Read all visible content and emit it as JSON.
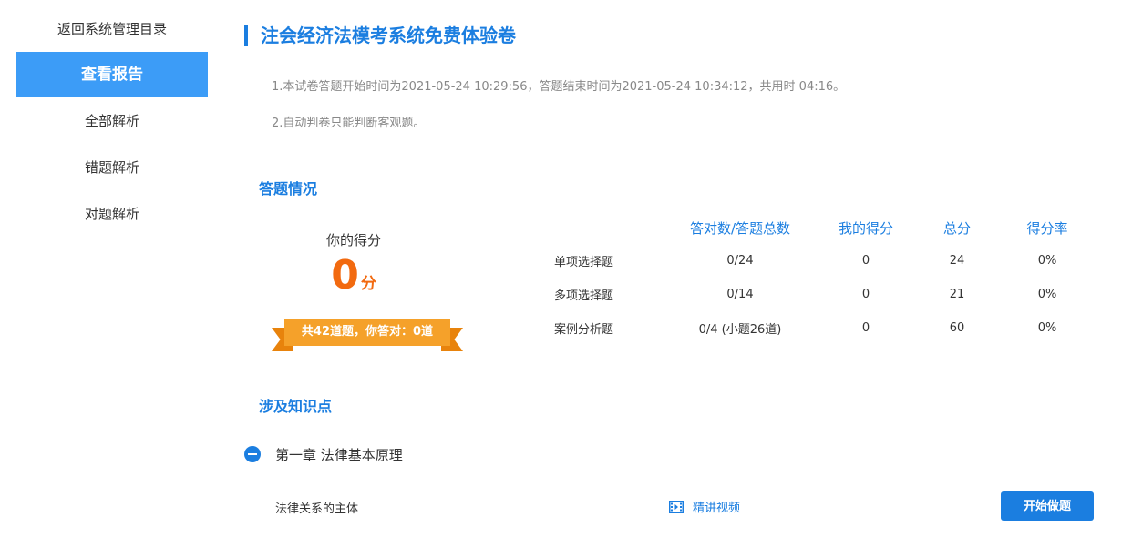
{
  "sidebar": {
    "items": [
      {
        "label": "返回系统管理目录"
      },
      {
        "label": "查看报告",
        "active": true
      },
      {
        "label": "全部解析"
      },
      {
        "label": "错题解析"
      },
      {
        "label": "对题解析"
      }
    ]
  },
  "main": {
    "title": "注会经济法模考系统免费体验卷",
    "notes": [
      "1.本试卷答题开始时间为2021-05-24 10:29:56，答题结束时间为2021-05-24 10:34:12，共用时 04:16。",
      "2.自动判卷只能判断客观题。"
    ],
    "answer_section": {
      "title": "答题情况",
      "score_label": "你的得分",
      "score_value": "0",
      "score_unit": "分",
      "ribbon_text": "共42道题，你答对：0道"
    },
    "results_table": {
      "headers": [
        "答对数/答题总数",
        "我的得分",
        "总分",
        "得分率"
      ],
      "rows": [
        {
          "type": "单项选择题",
          "correct": "0/24",
          "my_score": "0",
          "total": "24",
          "rate": "0%"
        },
        {
          "type": "多项选择题",
          "correct": "0/14",
          "my_score": "0",
          "total": "21",
          "rate": "0%"
        },
        {
          "type": "案例分析题",
          "correct": "0/4 (小题26道)",
          "my_score": "0",
          "total": "60",
          "rate": "0%"
        }
      ]
    },
    "knowledge": {
      "title": "涉及知识点",
      "chapter": "第一章  法律基本原理",
      "point": "法律关系的主体",
      "video_label": "精讲视频",
      "start_button": "开始做题"
    }
  },
  "colors": {
    "accent": "#1b7ee0",
    "sidebar_active": "#3c9cf7",
    "score_orange": "#f26a10",
    "ribbon": "#f5a12a"
  }
}
